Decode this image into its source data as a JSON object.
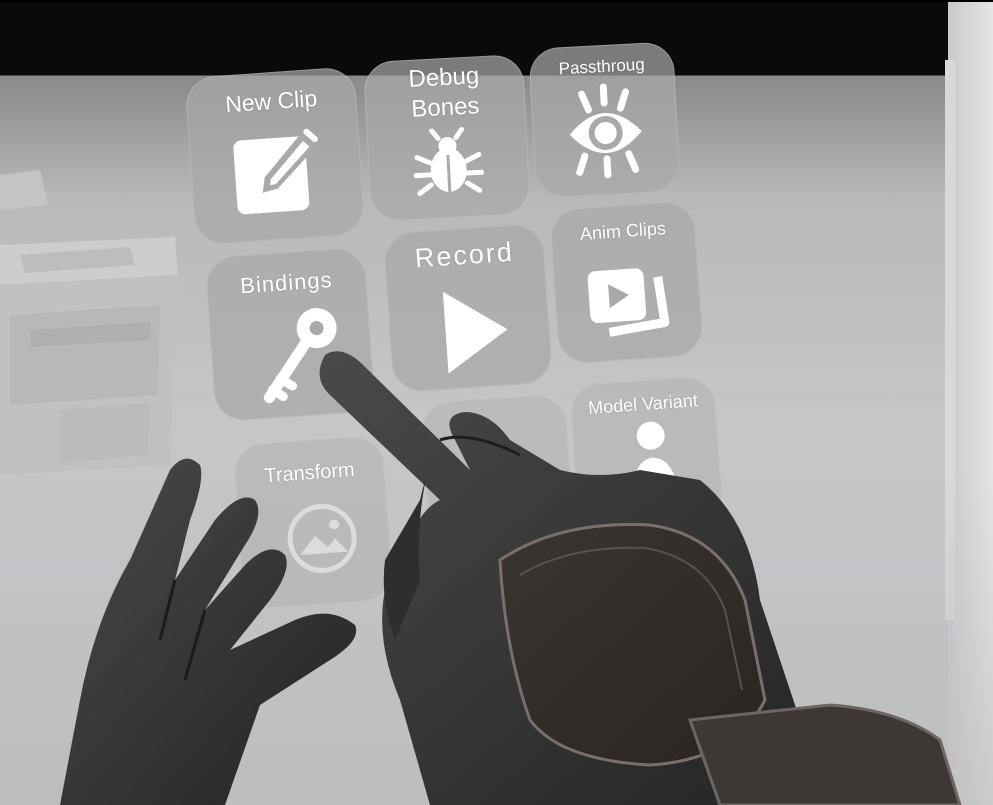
{
  "menu": {
    "tiles": [
      {
        "label": "New Clip",
        "icon": "edit-icon"
      },
      {
        "label": "Debug\nBones",
        "label_line1": "Debug",
        "label_line2": "Bones",
        "icon": "bug-icon"
      },
      {
        "label": "Passthroug",
        "icon": "eye-icon"
      },
      {
        "label": "Bindings",
        "icon": "key-icon"
      },
      {
        "label": "Record",
        "icon": "play-icon"
      },
      {
        "label": "Anim Clips",
        "icon": "video-library-icon"
      },
      {
        "label": "Transform",
        "icon": "image-icon"
      },
      {
        "label": "Model Variant",
        "icon": "person-icon"
      }
    ]
  }
}
